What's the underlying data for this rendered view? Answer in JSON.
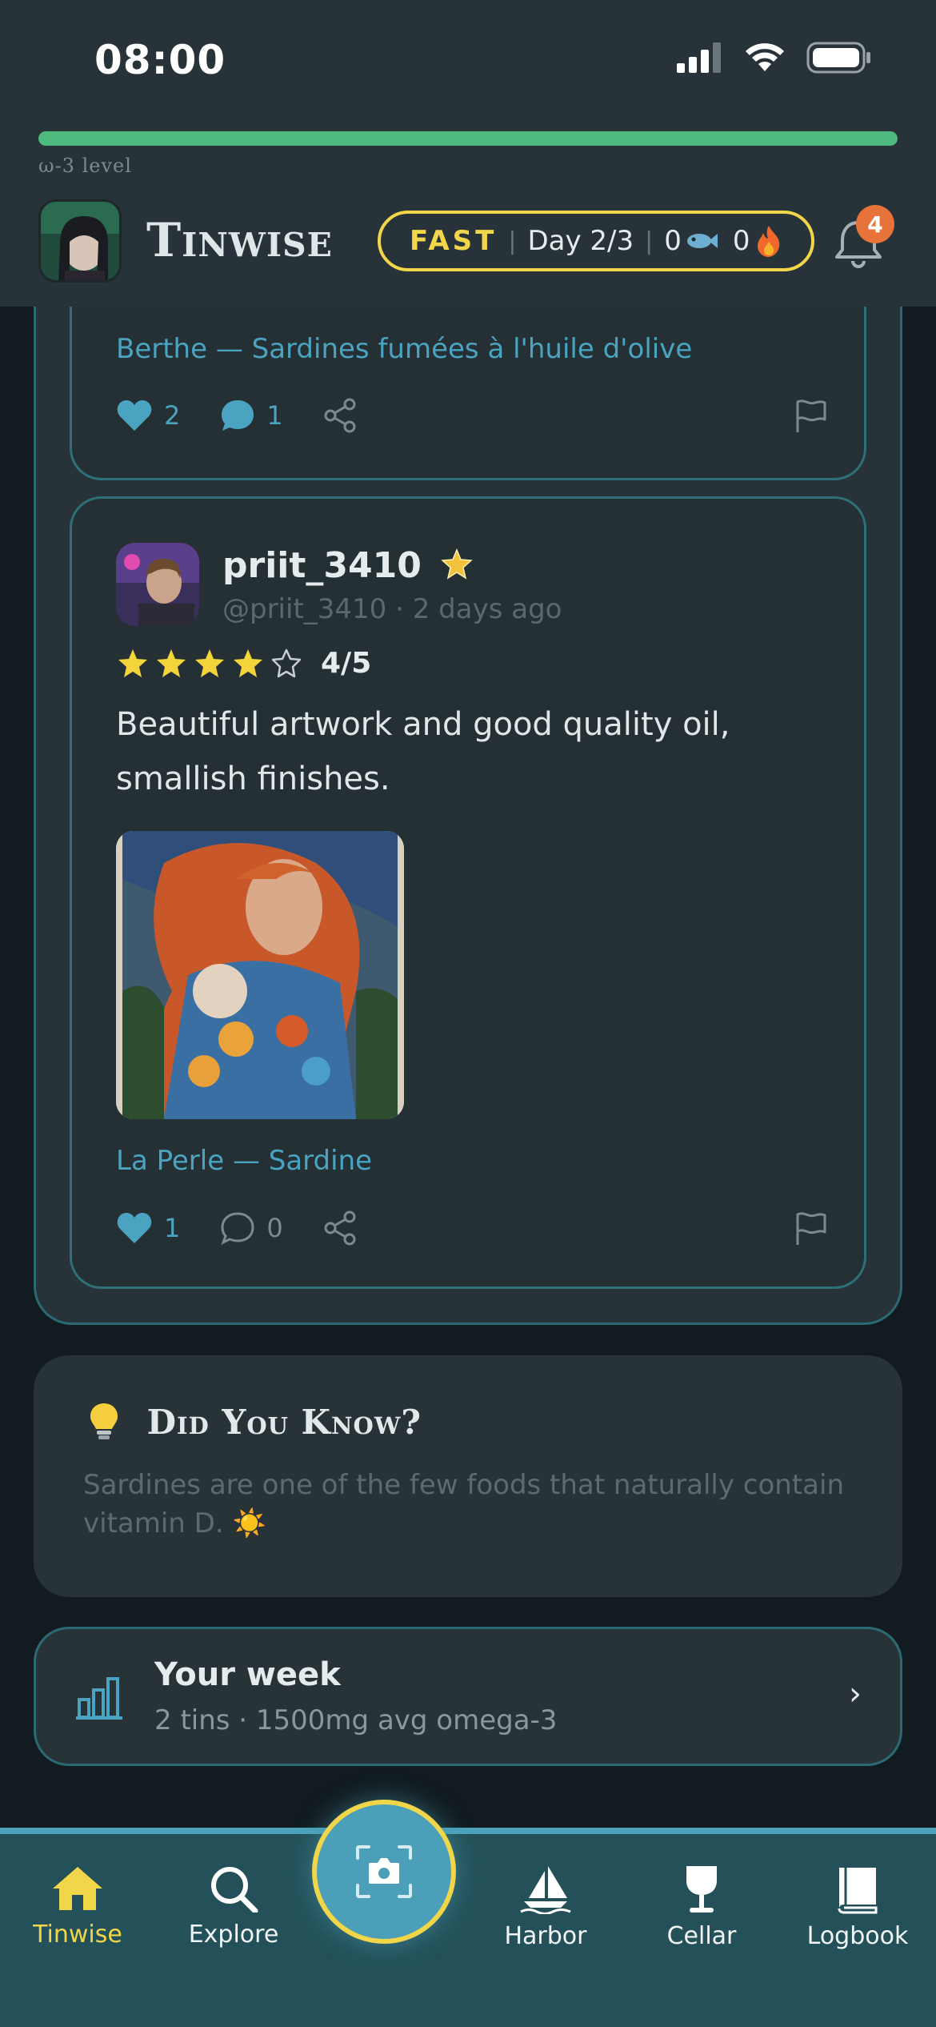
{
  "status_bar": {
    "time": "08:00"
  },
  "header": {
    "omega_label": "ω-3 level",
    "omega_progress": 1.0,
    "title": "Tinwise",
    "fast_label": "FAST",
    "fast_day": "Day 2/3",
    "fish_count": "0",
    "streak_count": "0",
    "notification_count": "4"
  },
  "feed": {
    "card_a": {
      "tin": "Berthe — Sardines fumées à l'huile d'olive",
      "likes": "2",
      "comments": "1"
    },
    "card_b": {
      "username": "priit_3410",
      "handle_time": "@priit_3410 · 2 days ago",
      "rating": 4,
      "rating_text": "4/5",
      "review_line1": "Beautiful artwork and good quality oil,",
      "review_line2": "smallish finishes.",
      "tin": "La Perle — Sardine",
      "likes": "1",
      "comments": "0"
    }
  },
  "did_you_know": {
    "title": "Did You Know?",
    "text": "Sardines are one of the few foods that naturally contain vitamin D. ☀️"
  },
  "your_week": {
    "title": "Your week",
    "summary": "2 tins · 1500mg avg omega-3",
    "chevron": "›"
  },
  "tabs": [
    {
      "label": "Tinwise",
      "icon": "home-icon",
      "active": true
    },
    {
      "label": "Explore",
      "icon": "search-icon",
      "active": false
    },
    {
      "label": "Harbor",
      "icon": "sailboat-icon",
      "active": false
    },
    {
      "label": "Cellar",
      "icon": "wine-glass-icon",
      "active": false
    },
    {
      "label": "Logbook",
      "icon": "book-icon",
      "active": false
    }
  ],
  "colors": {
    "accent_yellow": "#f1d64a",
    "link_blue": "#4aa3c0",
    "progress_green": "#4fba7e",
    "badge_orange": "#e8733a",
    "tabbar": "#245159"
  }
}
